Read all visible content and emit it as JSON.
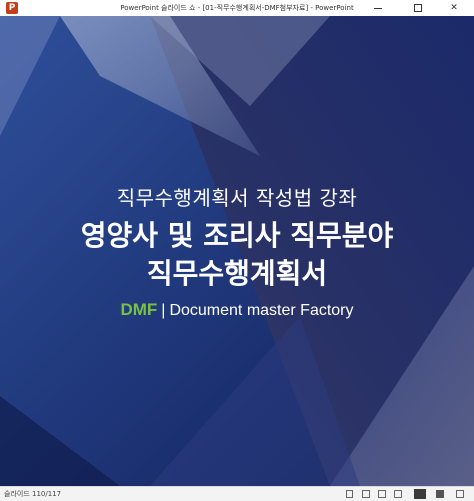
{
  "window": {
    "title": "PowerPoint 슬라이드 쇼 - [01-직무수행계획서-DMF첨부자료] - PowerPoint",
    "app_icon_letter": "P"
  },
  "slide": {
    "subtitle": "직무수행계획서 작성법 강좌",
    "title_line1": "영양사 및 조리사 직무분야",
    "title_line2": "직무수행계획서",
    "brand_name": "DMF",
    "brand_separator": "|",
    "brand_tagline": "Document master Factory",
    "colors": {
      "background": "#162359",
      "brand_green": "#7ac143",
      "text": "#ffffff"
    }
  },
  "statusbar": {
    "slide_counter": "슬라이드 110/117"
  }
}
